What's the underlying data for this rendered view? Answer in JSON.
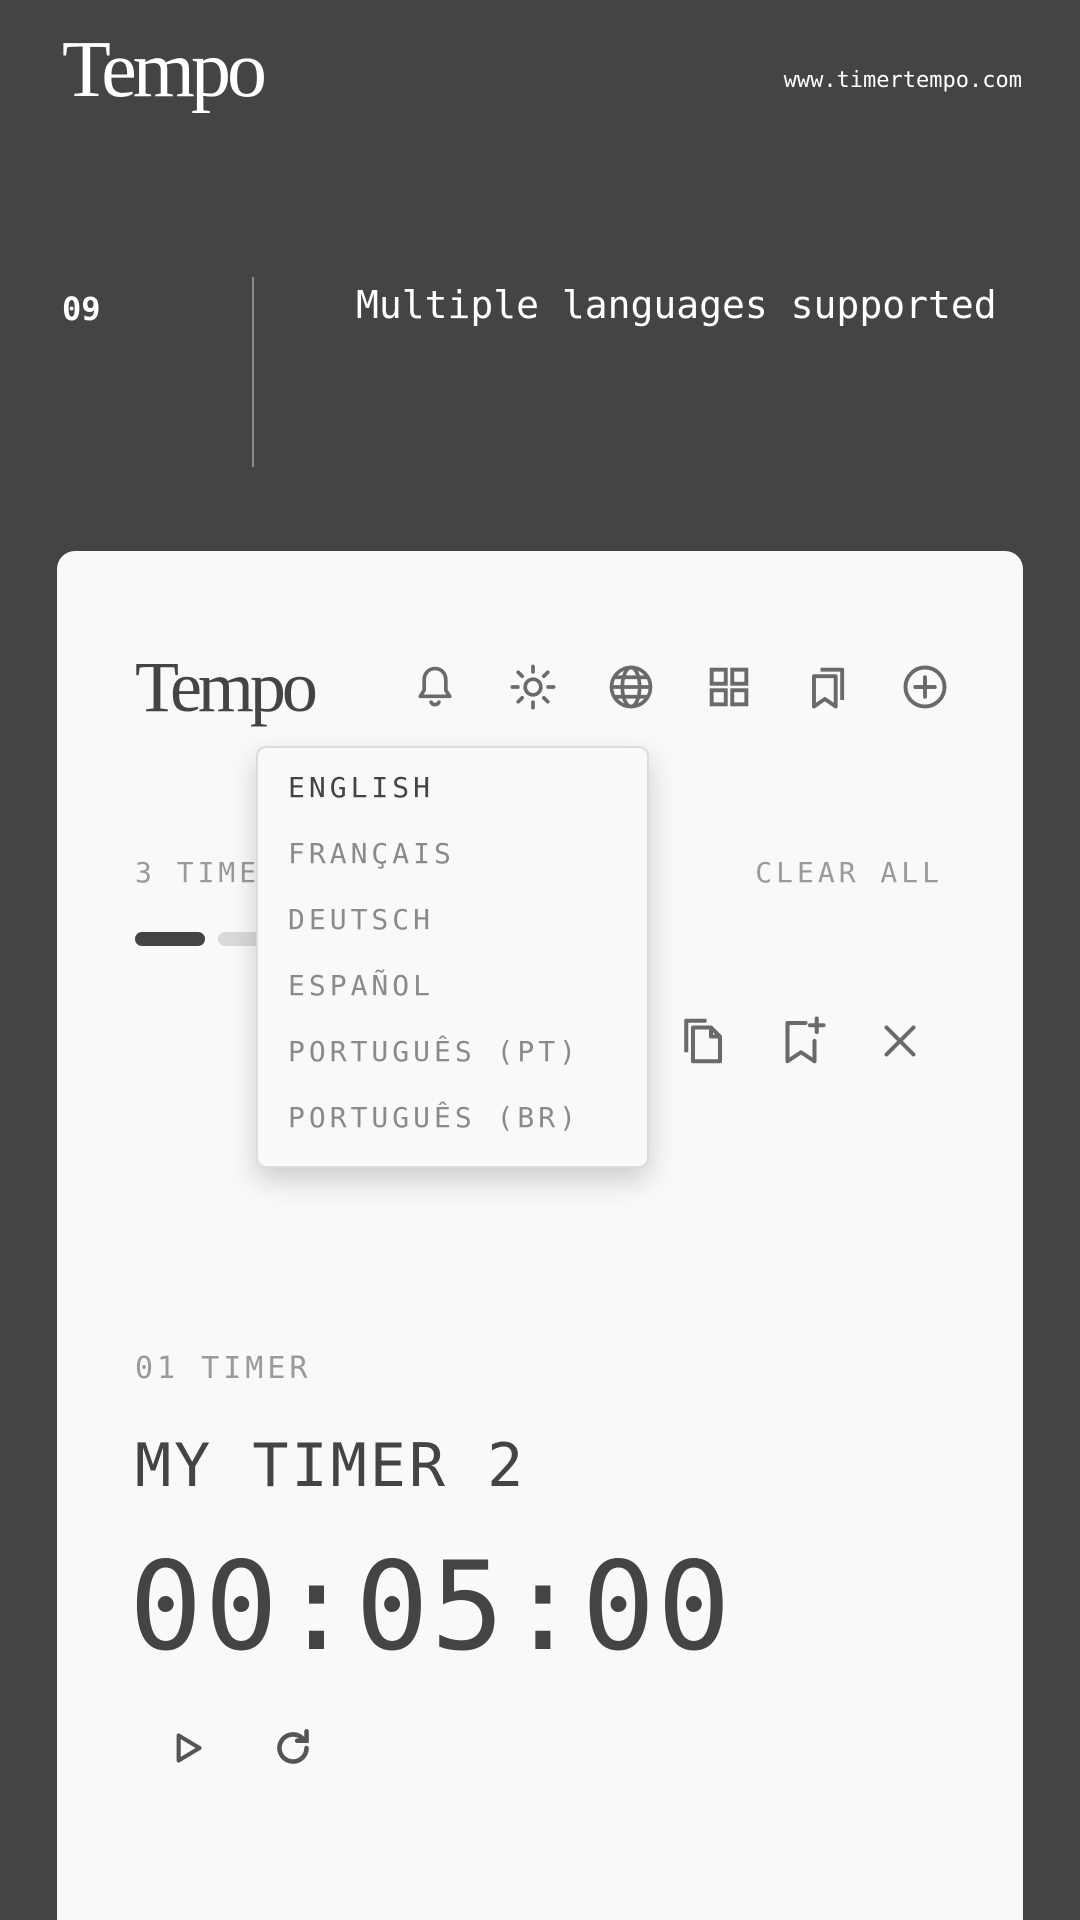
{
  "header": {
    "brand": "Tempo",
    "url": "www.timertempo.com"
  },
  "feature": {
    "number": "09",
    "title": "Multiple languages supported"
  },
  "app": {
    "logo": "Tempo",
    "toolbar_icons": [
      "bell-icon",
      "sun-icon",
      "globe-icon",
      "grid-icon",
      "bookmarks-icon",
      "plus-circle-icon"
    ],
    "timer_count_label": "3 TIMERS",
    "clear_all_label": "CLEAR ALL",
    "pager": {
      "total": 3,
      "active_index": 0
    },
    "timer_actions": [
      "copy-icon",
      "bookmark-add-icon",
      "close-icon"
    ]
  },
  "language_menu": {
    "items": [
      {
        "label": "ENGLISH",
        "selected": true
      },
      {
        "label": "FRANÇAIS",
        "selected": false
      },
      {
        "label": "DEUTSCH",
        "selected": false
      },
      {
        "label": "ESPAÑOL",
        "selected": false
      },
      {
        "label": "PORTUGUÊS (PT)",
        "selected": false
      },
      {
        "label": "PORTUGUÊS (BR)",
        "selected": false
      }
    ]
  },
  "timer": {
    "index_label": "01 TIMER",
    "name": "MY TIMER 2",
    "time": "00:05:00"
  },
  "controls": [
    "play-icon",
    "reset-icon"
  ],
  "colors": {
    "background": "#444444",
    "card": "#f9f9f8",
    "text_dark": "#444444",
    "text_muted": "#9a9a9a"
  }
}
